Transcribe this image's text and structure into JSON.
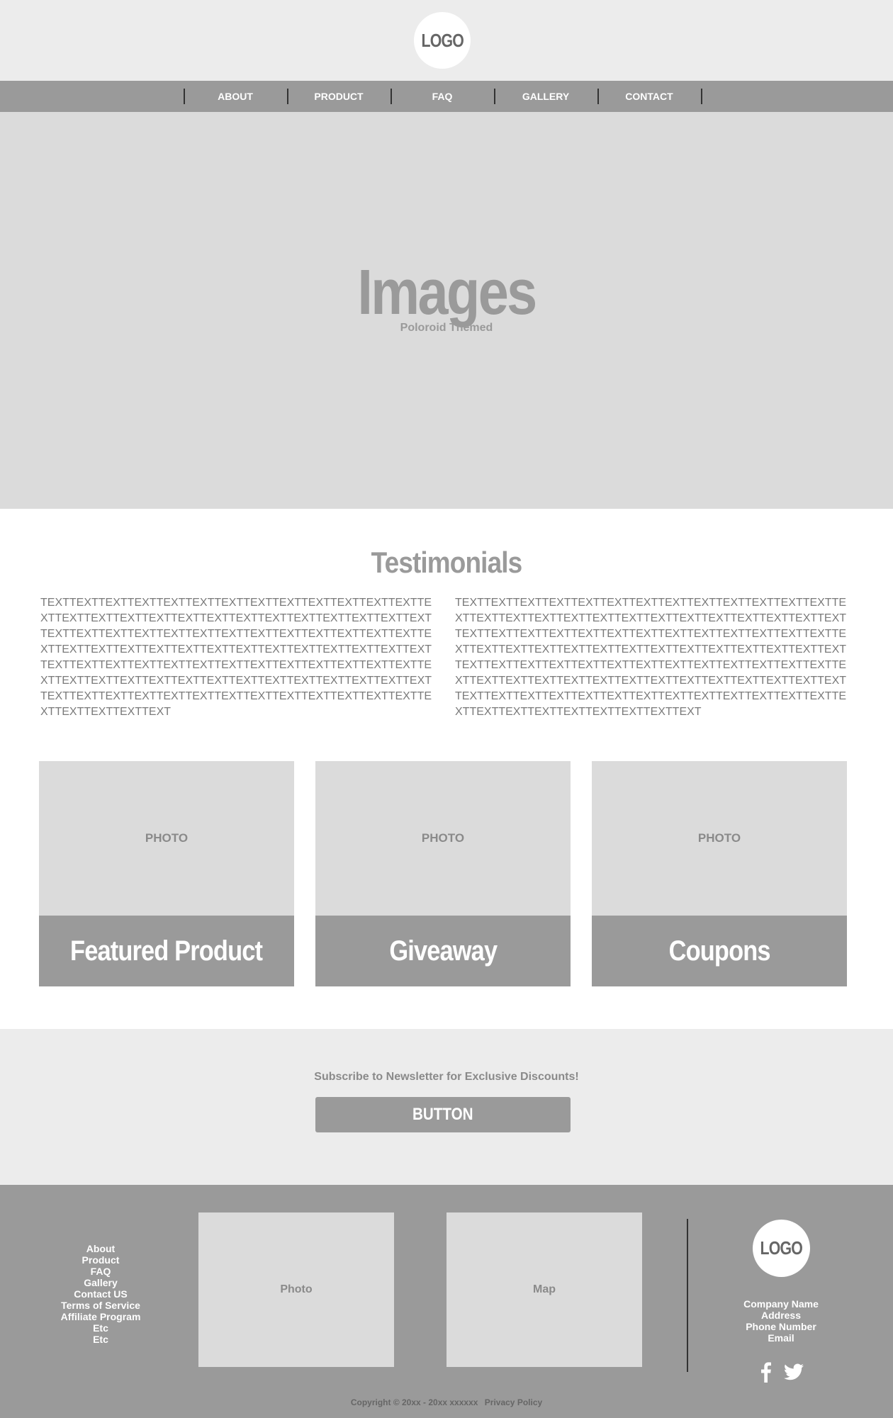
{
  "header": {
    "logo": "LOGO",
    "nav": [
      "ABOUT",
      "PRODUCT",
      "FAQ",
      "GALLERY",
      "CONTACT"
    ]
  },
  "hero": {
    "title": "Images",
    "subtitle": "Poloroid Themed"
  },
  "testimonials": {
    "title": "Testimonials",
    "left_text": "TEXTTEXTTEXTTEXTTEXTTEXTTEXTTEXTTEXTTEXTTEXTTEXTTEXTTEXTTEXTTEXTTEXTTEXTTEXTTEXTTEXTTEXTTEXTTEXTTEXTTEXTTEXTTEXTTEXTTEXTTEXTTEXTTEXTTEXTTEXTTEXTTEXTTEXTTEXTTEXTTEXTTEXTTEXTTEXTTEXTTEXTTEXTTEXTTEXTTEXTTEXTTEXTTEXTTEXTTEXTTEXTTEXTTEXTTEXTTEXTTEXTTEXTTEXTTEXTTEXTTEXTTEXTTEXTTEXTTEXTTEXTTEXTTEXTTEXTTEXTTEXTTEXTTEXTTEXTTEXTTEXTTEXTTEXTTEXTTEXTTEXTTEXTTEXTTEXTTEXTTEXTTEXTTEXTTEXTTEXTTEXTTEXTTEXTTEXT",
    "right_text": "TEXTTEXTTEXTTEXTTEXTTEXTTEXTTEXTTEXTTEXTTEXTTEXTTEXTTEXTTEXTTEXTTEXTTEXTTEXTTEXTTEXTTEXTTEXTTEXTTEXTTEXTTEXTTEXTTEXTTEXTTEXTTEXTTEXTTEXTTEXTTEXTTEXTTEXTTEXTTEXTTEXTTEXTTEXTTEXTTEXTTEXTTEXTTEXTTEXTTEXTTEXTTEXTTEXTTEXTTEXTTEXTTEXTTEXTTEXTTEXTTEXTTEXTTEXTTEXTTEXTTEXTTEXTTEXTTEXTTEXTTEXTTEXTTEXTTEXTTEXTTEXTTEXTTEXTTEXTTEXTTEXTTEXTTEXTTEXTTEXTTEXTTEXTTEXTTEXTTEXTTEXTTEXTTEXTTEXTTEXTTEXTTEXTTEXTTEXTTEXTTEXTTEXTTEXT"
  },
  "cards": [
    {
      "photo": "PHOTO",
      "label": "Featured Product"
    },
    {
      "photo": "PHOTO",
      "label": "Giveaway"
    },
    {
      "photo": "PHOTO",
      "label": "Coupons"
    }
  ],
  "newsletter": {
    "text": "Subscribe to Newsletter for Exclusive Discounts!",
    "button": "BUTTON"
  },
  "footer": {
    "links": [
      "About",
      "Product",
      "FAQ",
      "Gallery",
      "Contact US",
      "Terms of Service",
      "Affiliate Program",
      "Etc",
      "Etc"
    ],
    "photo": "Photo",
    "map": "Map",
    "logo": "LOGO",
    "company": [
      "Company Name",
      "Address",
      "Phone Number",
      "Email"
    ],
    "social_icons": [
      "facebook-icon",
      "twitter-icon"
    ],
    "copyright": "Copyright © 20xx - 20xx xxxxxx",
    "privacy": "Privacy Policy"
  },
  "colors": {
    "header_bg": "#ececec",
    "nav_bg": "#9a9a9a",
    "placeholder_bg": "#dbdbdb",
    "accent_gray": "#9a9a9a"
  }
}
